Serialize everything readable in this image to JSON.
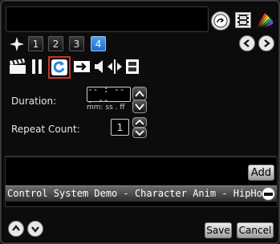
{
  "toolbar_numbers": [
    "1",
    "2",
    "3",
    "4"
  ],
  "active_number": "4",
  "icons": {
    "top": [
      "preset-dial-icon",
      "filmstrip-icon",
      "color-palette-icon"
    ],
    "nav": [
      "arrow-left-icon",
      "arrow-right-icon"
    ],
    "actions": [
      "clapper-icon",
      "pause-icon",
      "repeat-icon",
      "jump-arrow-icon",
      "volume-icon",
      "split-icon",
      "film-frame-icon"
    ]
  },
  "duration": {
    "label": "Duration:",
    "value": "-- : -- . --",
    "hint": "mm: ss . ff"
  },
  "repeat": {
    "label": "Repeat Count:",
    "value": "1"
  },
  "add_label": "Add",
  "list_items": [
    "Control System Demo - Character Anim - HipHo"
  ],
  "save_label": "Save",
  "cancel_label": "Cancel",
  "colors": {
    "accent": "#2f86e0",
    "highlight": "#d0322a"
  }
}
